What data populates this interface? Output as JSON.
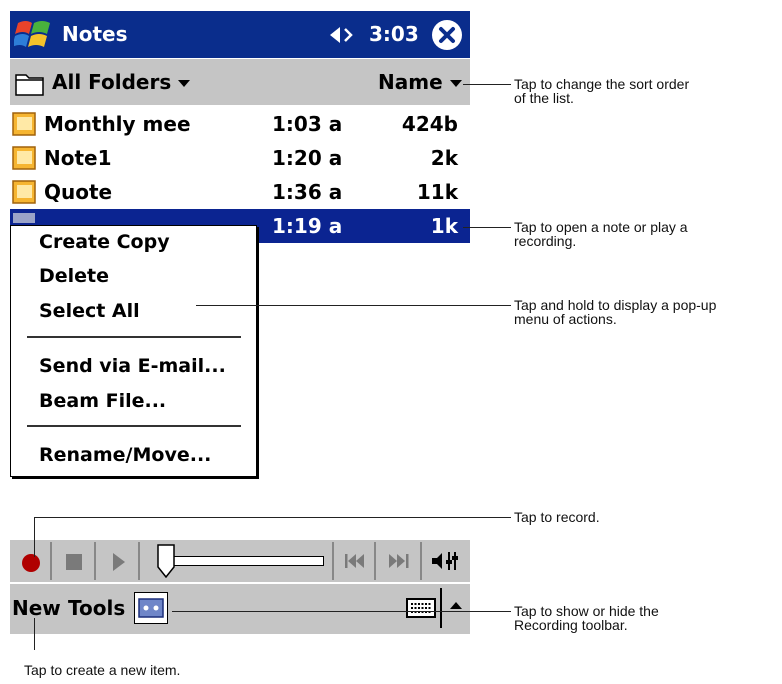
{
  "title_bar": {
    "app_name": "Notes",
    "time": "3:03",
    "speaker_glyph": "◀",
    "sound_glyph": "ᶘ"
  },
  "folder_bar": {
    "folder_label": "All Folders",
    "sort_label": "Name"
  },
  "notes": [
    {
      "name": "Monthly mee",
      "time": "1:03 a",
      "size": "424b",
      "selected": false
    },
    {
      "name": "Note1",
      "time": "1:20 a",
      "size": "2k",
      "selected": false
    },
    {
      "name": "Quote",
      "time": "1:36 a",
      "size": "11k",
      "selected": false
    },
    {
      "name": "",
      "time": "1:19 a",
      "size": "1k",
      "selected": true
    }
  ],
  "context_menu": {
    "items": [
      "Create Copy",
      "Delete",
      "Select All",
      "Send via E-mail...",
      "Beam File...",
      "Rename/Move..."
    ]
  },
  "command_bar": {
    "new_label": "New",
    "tools_label": "Tools"
  },
  "callouts": {
    "sort_order": [
      "Tap to change the sort order",
      "of the list."
    ],
    "open_note": [
      "Tap to open a note or play a",
      "recording."
    ],
    "popup_menu": [
      "Tap and hold to display a pop-up",
      "menu of actions."
    ],
    "record": [
      "Tap to record."
    ],
    "toggle_toolbar": [
      "Tap to show or hide the",
      "Recording toolbar."
    ],
    "new_item": [
      "Tap to create a new item."
    ]
  },
  "colors": {
    "title_bar": "#0a2d8c",
    "selection": "#0b2491",
    "bar_gray": "#c5c5c5",
    "record_red": "#b00000"
  }
}
